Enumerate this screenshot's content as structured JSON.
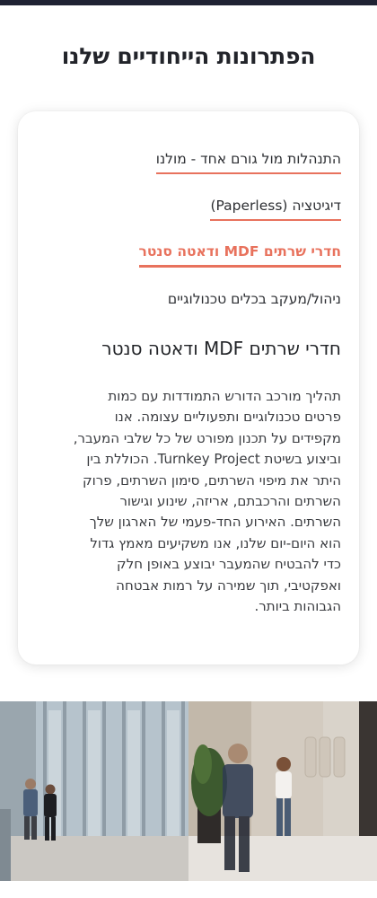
{
  "section": {
    "title": "הפתרונות הייחודיים שלנו"
  },
  "tabs": [
    {
      "label": "התנהלות מול גורם אחד - מולנו"
    },
    {
      "label": "דיגיטציה (Paperless)"
    },
    {
      "label": "חדרי שרתים MDF ודאטה סנטר"
    },
    {
      "label": "ניהול/מעקב בכלים טכנולוגיים"
    }
  ],
  "active_tab_index": 2,
  "panel": {
    "heading": "חדרי שרתים MDF ודאטה סנטר",
    "body_lines": [
      "תהליך מורכב הדורש התמודדות עם כמות",
      "פרטים טכנולוגיים ותפעוליים עצומה. אנו",
      "מקפידים על תכנון מפורט של כל שלבי המעבר,",
      "וביצוע בשיטת Turnkey Project. הכוללת בין",
      "היתר את מיפוי השרתים, סימון השרתים, פרוק",
      "השרתים והרכבתם, אריזה, שינוע וגישור",
      "השרתים. האירוע החד-פעמי של הארגון שלך",
      "הוא היום-יום שלנו, אנו משקיעים מאמץ גדול",
      "כדי להבטיח שהמעבר יבוצע באופן חלק",
      "ואפקטיבי, תוך שמירה על רמות אבטחה",
      "הגבוהות ביותר."
    ]
  },
  "colors": {
    "accent": "#e8725d",
    "top_bar": "#1f2233",
    "text": "#232428"
  },
  "photo": {
    "description": "office-and-building-photo"
  }
}
